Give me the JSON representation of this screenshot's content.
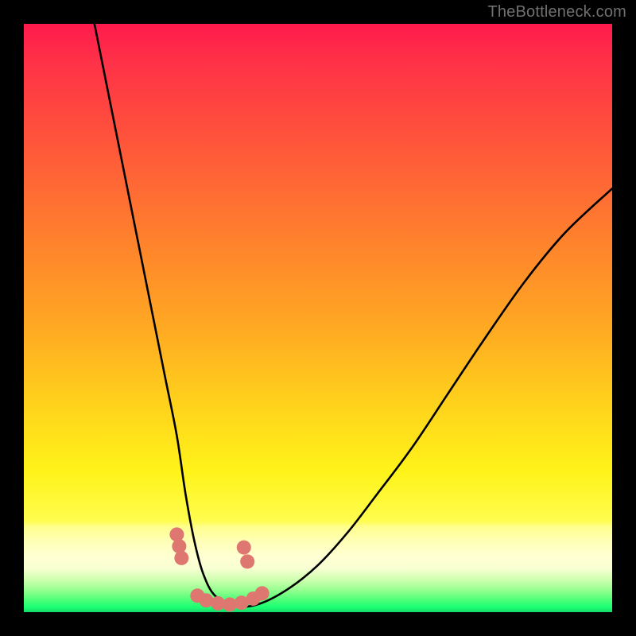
{
  "watermark": "TheBottleneck.com",
  "colors": {
    "frame": "#000000",
    "curve_stroke": "#000000",
    "marker_fill": "#de776f",
    "gradient_top": "#ff1a4d",
    "gradient_bottom": "#15d86a"
  },
  "chart_data": {
    "type": "line",
    "title": "",
    "xlabel": "",
    "ylabel": "",
    "axes_visible": false,
    "grid": false,
    "xlim": [
      0,
      100
    ],
    "ylim": [
      0,
      100
    ],
    "background": "vertical-gradient red→yellow→green",
    "series": [
      {
        "name": "bottleneck-curve",
        "x": [
          12,
          14,
          16,
          18,
          20,
          22,
          24,
          26,
          27.5,
          29,
          30.5,
          32.5,
          36,
          40,
          45,
          50,
          55,
          60,
          66,
          72,
          78,
          85,
          92,
          100
        ],
        "values": [
          100,
          90,
          80,
          70,
          60,
          50,
          40,
          30,
          20,
          12,
          6.5,
          2.8,
          1.0,
          1.4,
          4.0,
          8.0,
          13.5,
          20,
          28,
          37,
          46,
          56,
          64.5,
          72
        ]
      }
    ],
    "markers": {
      "name": "highlight-dots",
      "color": "#de776f",
      "points_xy": [
        [
          26.0,
          13.2
        ],
        [
          26.4,
          11.2
        ],
        [
          26.8,
          9.2
        ],
        [
          29.5,
          2.8
        ],
        [
          31.0,
          2.0
        ],
        [
          33.0,
          1.5
        ],
        [
          35.0,
          1.3
        ],
        [
          37.0,
          1.6
        ],
        [
          39.0,
          2.3
        ],
        [
          40.5,
          3.2
        ],
        [
          37.4,
          11.0
        ],
        [
          38.0,
          8.6
        ]
      ],
      "radius_px": 9
    }
  }
}
